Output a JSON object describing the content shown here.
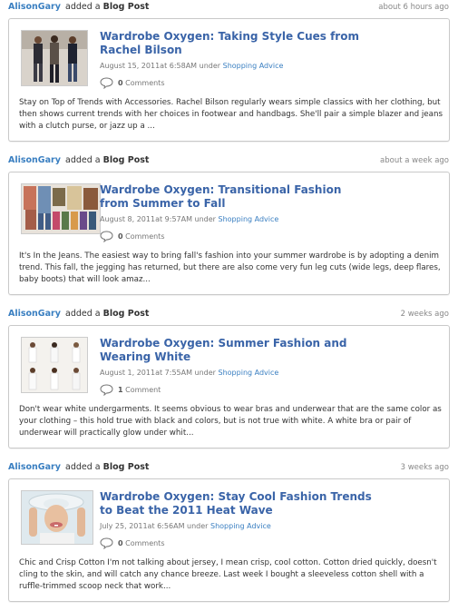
{
  "activities": [
    {
      "actor": "AlisonGary",
      "action_text": "added a",
      "action_type": "Blog Post",
      "time": "about 6 hours ago",
      "post": {
        "title": "Wardrobe Oxygen: Taking Style Cues from Rachel Bilson",
        "date": "August 15, 2011at 6:58AM under",
        "category": "Shopping Advice",
        "comments_count": "0",
        "comments_label": "Comments",
        "excerpt": "Stay on Top of Trends with Accessories. Rachel Bilson regularly wears simple classics with her clothing, but then shows current trends with her choices in footwear and handbags. She'll pair a simple blazer and jeans with a clutch purse, or jazz up a ..."
      }
    },
    {
      "actor": "AlisonGary",
      "action_text": "added a",
      "action_type": "Blog Post",
      "time": "about a week ago",
      "post": {
        "title": "Wardrobe Oxygen: Transitional Fashion from Summer to Fall",
        "date": "August 8, 2011at 9:57AM under",
        "category": "Shopping Advice",
        "comments_count": "0",
        "comments_label": "Comments",
        "excerpt": "It's In the Jeans. The easiest way to bring fall's fashion into your summer wardrobe is by adopting a denim trend. This fall, the jegging has returned, but there are also come very fun leg cuts (wide legs, deep flares, baby boots) that will look amaz..."
      }
    },
    {
      "actor": "AlisonGary",
      "action_text": "added a",
      "action_type": "Blog Post",
      "time": "2 weeks ago",
      "post": {
        "title": "Wardrobe Oxygen: Summer Fashion and Wearing White",
        "date": "August 1, 2011at 7:55AM under",
        "category": "Shopping Advice",
        "comments_count": "1",
        "comments_label": "Comment",
        "excerpt": "Don't wear white undergarments. It seems obvious to wear bras and underwear that are the same color as your clothing – this hold true with black and colors, but is not true with white. A white bra or pair of underwear will practically glow under whit..."
      }
    },
    {
      "actor": "AlisonGary",
      "action_text": "added a",
      "action_type": "Blog Post",
      "time": "3 weeks ago",
      "post": {
        "title": "Wardrobe Oxygen: Stay Cool Fashion Trends to Beat the 2011 Heat Wave",
        "date": "July 25, 2011at 6:56AM under",
        "category": "Shopping Advice",
        "comments_count": "0",
        "comments_label": "Comments",
        "excerpt": "Chic and Crisp Cotton I'm not talking about jersey, I mean crisp, cool cotton. Cotton dried quickly, doesn't cling to the skin, and will catch any chance breeze. Last week I bought a sleeveless cotton shell with a ruffle-trimmed scoop neck that work..."
      }
    }
  ],
  "colors": {
    "link": "#3a7fc1",
    "title": "#3a64a8",
    "meta": "#777777",
    "border": "#c9c9c9"
  },
  "icons": {
    "comment": "comment-bubble-icon"
  }
}
